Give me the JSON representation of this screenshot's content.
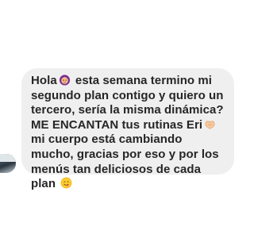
{
  "message": {
    "sender_avatar": "contact-avatar",
    "segments": [
      "Hola",
      " esta semana termino mi segundo plan contigo y quiero un tercero, sería la misma dinámica? ME ENCANTAN tus rutinas Eri",
      " mi cuerpo está cambiando mucho, gracias por eso y por los menús tan deliciosos de cada plan "
    ],
    "emojis": [
      "woman-emoji",
      "heart-hands-emoji",
      "yum-face-emoji"
    ]
  },
  "colors": {
    "bubble": "#efefef",
    "text": "#262626",
    "background": "#ffffff"
  }
}
